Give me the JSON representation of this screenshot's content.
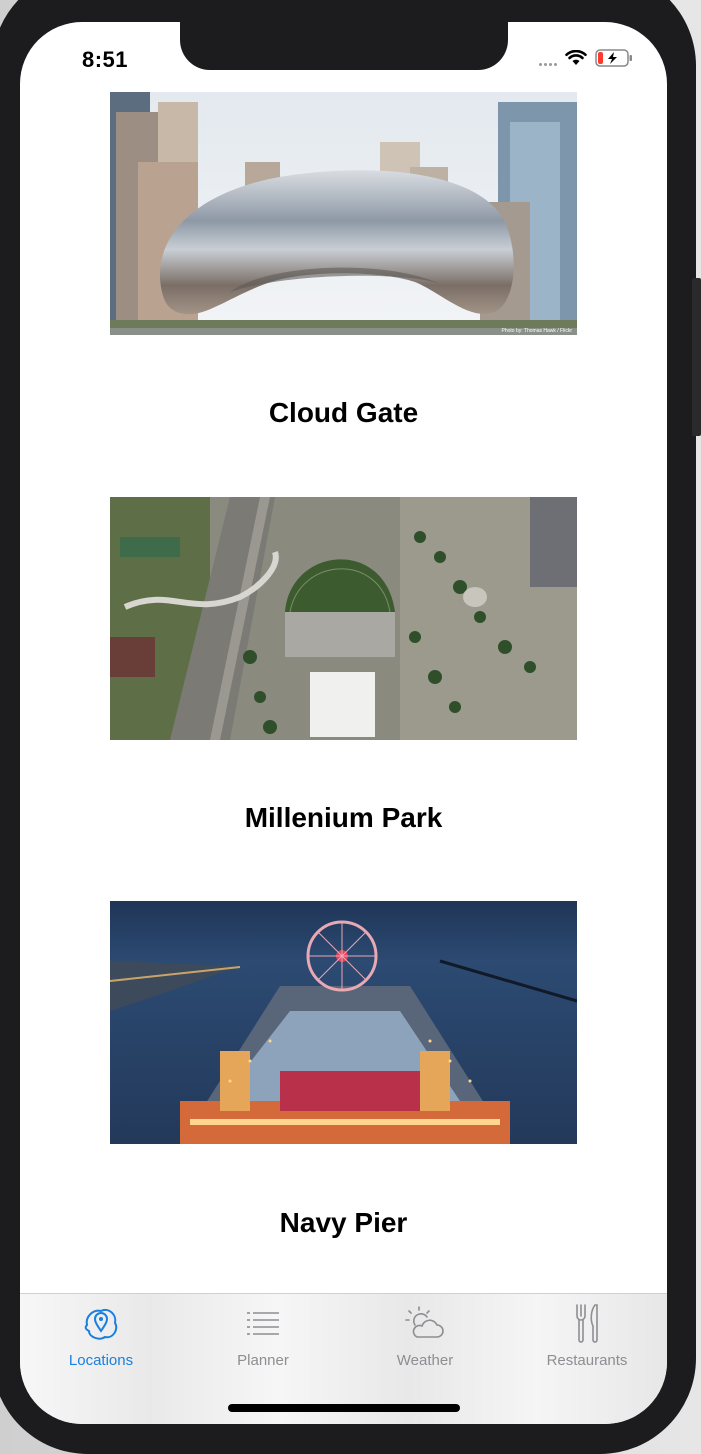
{
  "status_bar": {
    "time": "8:51"
  },
  "locations": [
    {
      "title": "Cloud Gate",
      "image_icon": "cloud-gate-photo",
      "photo_credit": "Photo by: Thomas Hawk / Flickr"
    },
    {
      "title": "Millenium Park",
      "image_icon": "millenium-park-photo"
    },
    {
      "title": "Navy Pier",
      "image_icon": "navy-pier-photo"
    }
  ],
  "tab_bar": {
    "tabs": [
      {
        "label": "Locations",
        "icon": "map-pin-icon",
        "active": true
      },
      {
        "label": "Planner",
        "icon": "list-icon",
        "active": false
      },
      {
        "label": "Weather",
        "icon": "sun-cloud-icon",
        "active": false
      },
      {
        "label": "Restaurants",
        "icon": "fork-knife-icon",
        "active": false
      }
    ]
  },
  "colors": {
    "accent": "#1a7fe0",
    "inactive": "#8e8e93",
    "frame": "#1c1c1e"
  }
}
